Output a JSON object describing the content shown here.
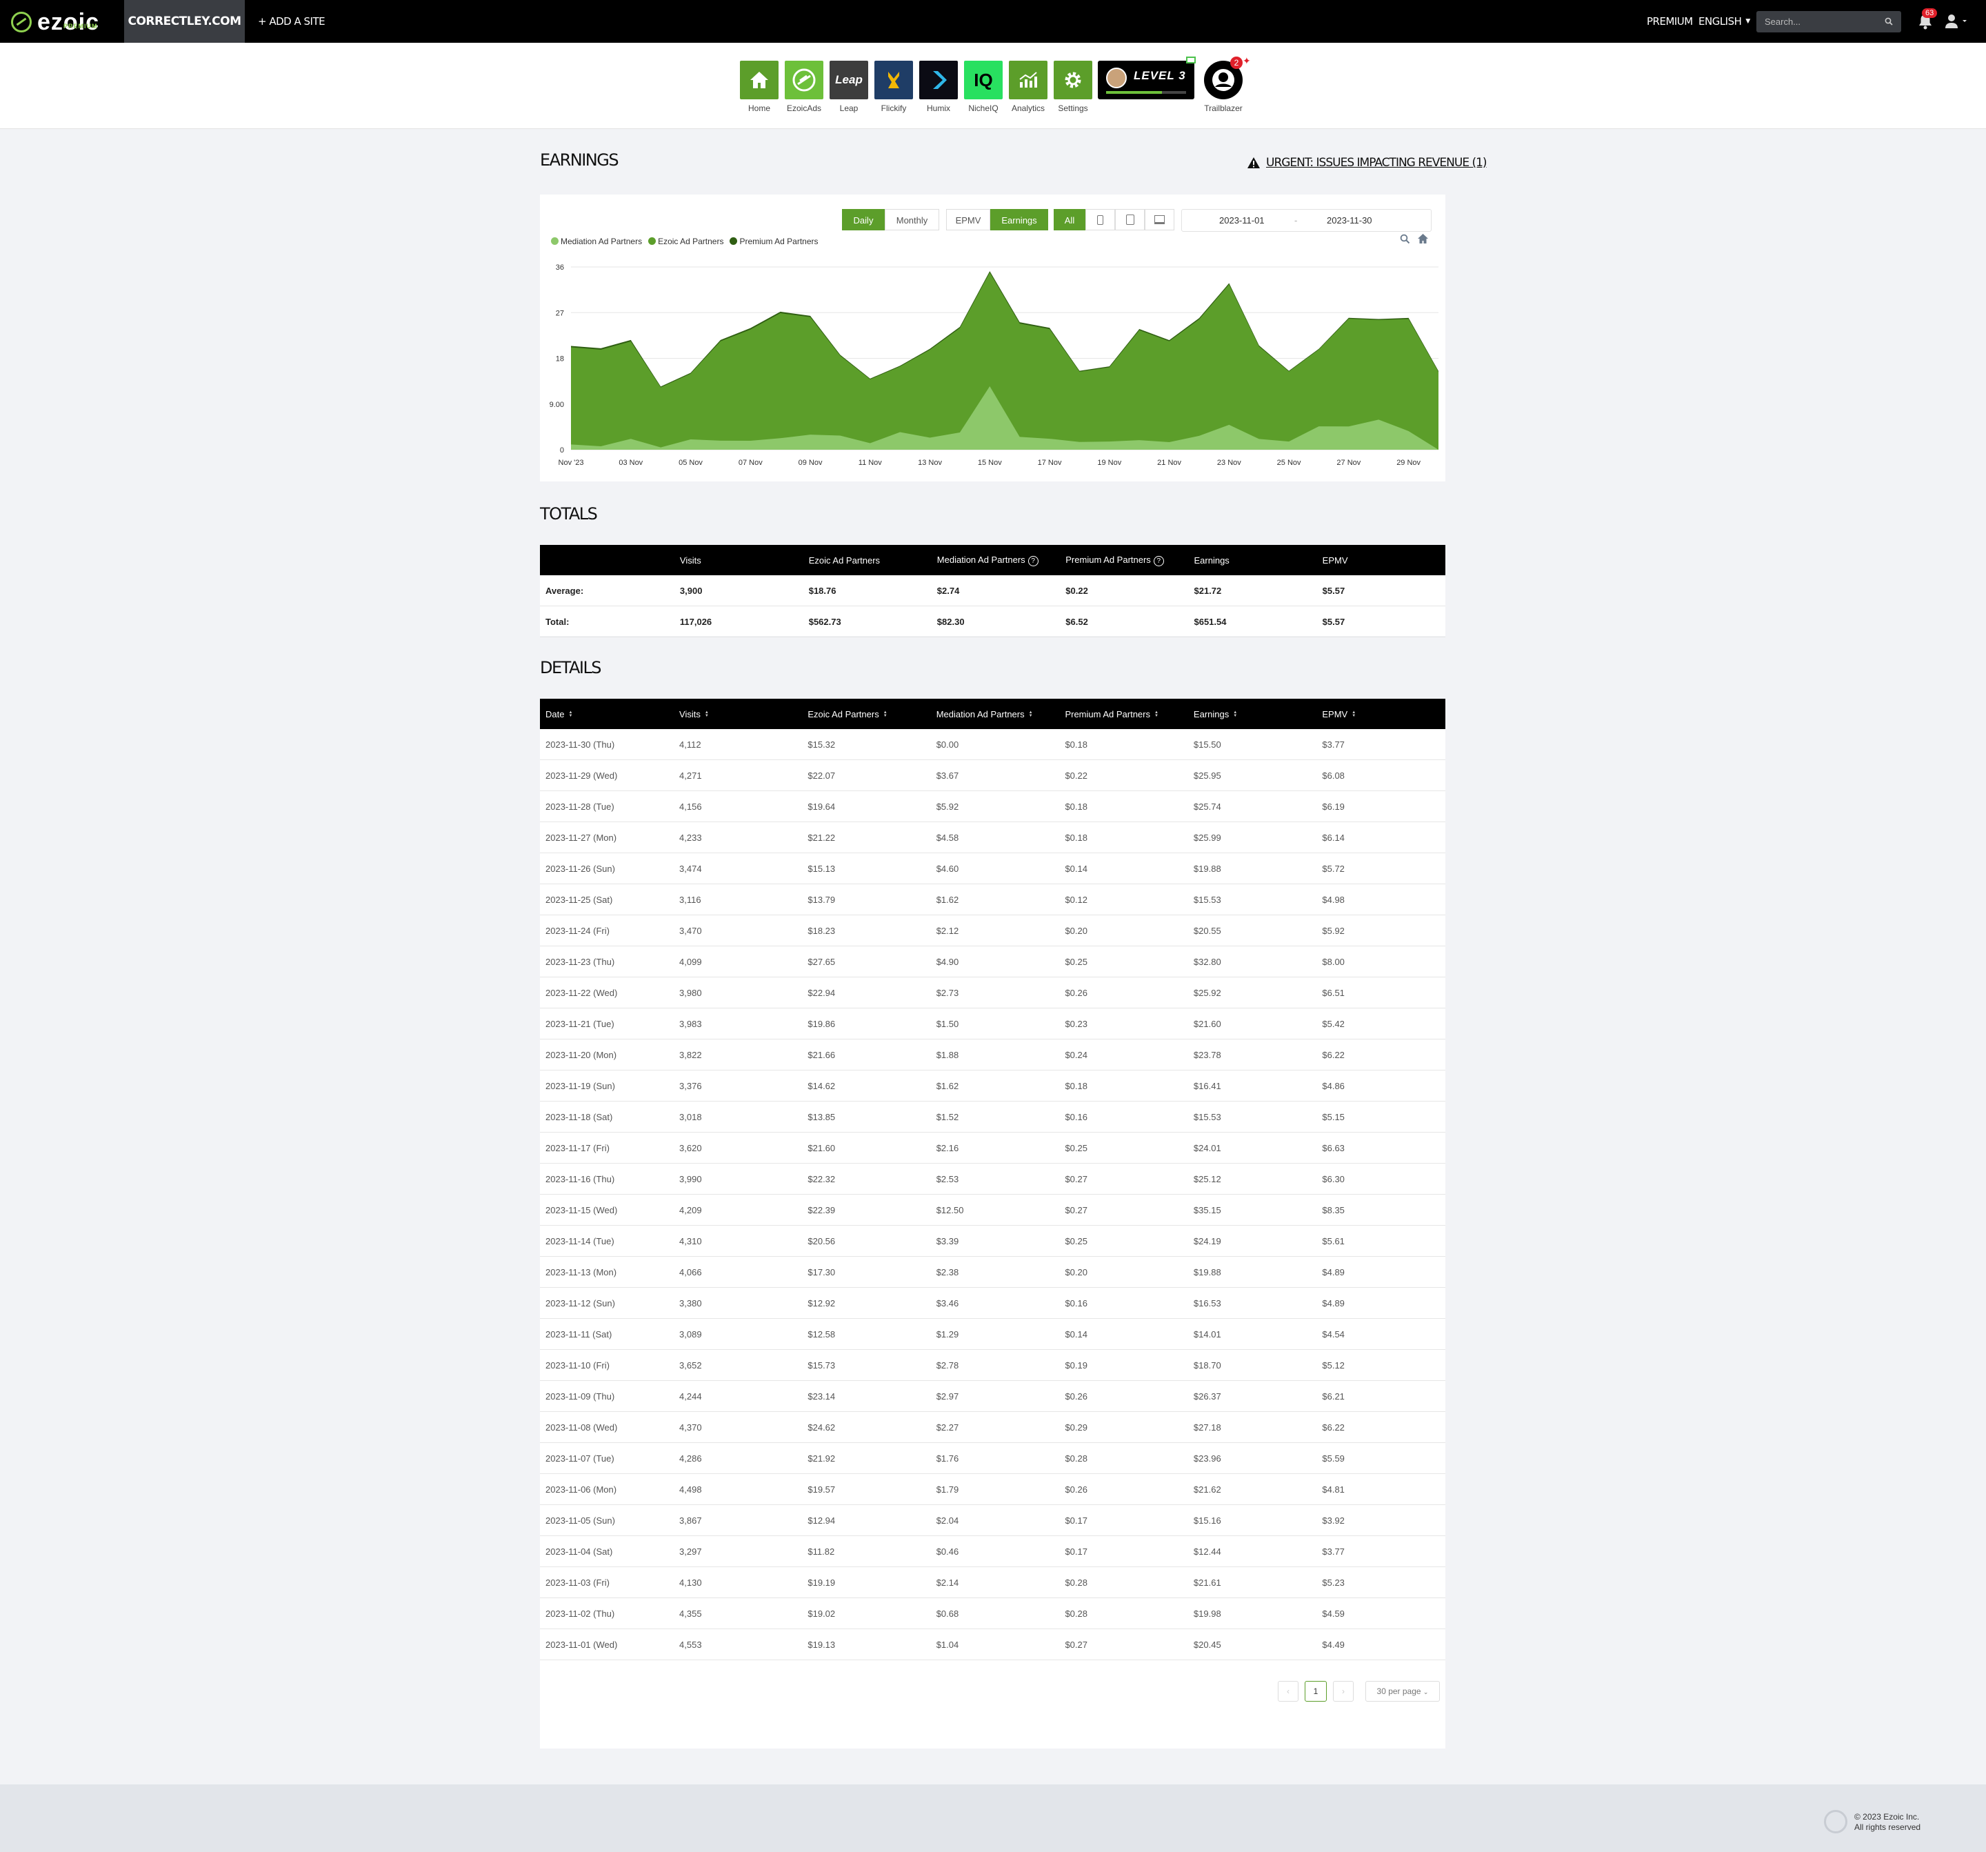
{
  "topbar": {
    "logo": "ezoic",
    "logo_sub": "PREMIUM",
    "site": "CORRECTLEY.COM",
    "add_site": "+ ADD A SITE",
    "premium": "PREMIUM",
    "language": "ENGLISH",
    "search_placeholder": "Search...",
    "notifications": "63"
  },
  "nav": [
    {
      "label": "Home",
      "color": "#5c9e2a",
      "icon": "home-icon"
    },
    {
      "label": "EzoicAds",
      "color": "#6dc03a",
      "icon": "ezoicads-icon"
    },
    {
      "label": "Leap",
      "color": "#3d3d3d",
      "icon": "leap-icon",
      "text": "Leap"
    },
    {
      "label": "Flickify",
      "color": "#1f3d66",
      "icon": "flickify-icon"
    },
    {
      "label": "Humix",
      "color": "#0b0b14",
      "icon": "humix-icon"
    },
    {
      "label": "NicheIQ",
      "color": "#28e060",
      "icon": "nicheiq-icon",
      "text": "IQ"
    },
    {
      "label": "Analytics",
      "color": "#5c9e2a",
      "icon": "analytics-icon"
    },
    {
      "label": "Settings",
      "color": "#5c9e2a",
      "icon": "settings-icon"
    }
  ],
  "level": "LEVEL 3",
  "trailblazer": {
    "label": "Trailblazer",
    "badge": "2"
  },
  "earnings": {
    "title": "EARNINGS",
    "urgent": "URGENT: ISSUES IMPACTING REVENUE (1)",
    "buttons": {
      "daily": "Daily",
      "monthly": "Monthly",
      "epmv": "EPMV",
      "earnings": "Earnings",
      "all": "All"
    },
    "date_from": "2023-11-01",
    "date_sep": "-",
    "date_to": "2023-11-30"
  },
  "chart_data": {
    "type": "area",
    "stacked": true,
    "x": [
      "Nov '23",
      "02 Nov",
      "03 Nov",
      "04 Nov",
      "05 Nov",
      "06 Nov",
      "07 Nov",
      "08 Nov",
      "09 Nov",
      "10 Nov",
      "11 Nov",
      "12 Nov",
      "13 Nov",
      "14 Nov",
      "15 Nov",
      "16 Nov",
      "17 Nov",
      "18 Nov",
      "19 Nov",
      "20 Nov",
      "21 Nov",
      "22 Nov",
      "23 Nov",
      "24 Nov",
      "25 Nov",
      "26 Nov",
      "27 Nov",
      "28 Nov",
      "29 Nov",
      "30 Nov"
    ],
    "x_tick_labels": [
      "Nov '23",
      "03 Nov",
      "05 Nov",
      "07 Nov",
      "09 Nov",
      "11 Nov",
      "13 Nov",
      "15 Nov",
      "17 Nov",
      "19 Nov",
      "21 Nov",
      "23 Nov",
      "25 Nov",
      "27 Nov",
      "29 Nov"
    ],
    "y_ticks": [
      "0",
      "9.00",
      "18",
      "27",
      "36"
    ],
    "ylim": [
      0,
      36
    ],
    "grid": true,
    "legend": "top-left",
    "series": [
      {
        "name": "Mediation Ad Partners",
        "color": "#8dc86a",
        "values": [
          1.04,
          0.68,
          2.14,
          0.46,
          2.04,
          1.79,
          1.76,
          2.27,
          2.97,
          2.78,
          1.29,
          3.46,
          2.38,
          3.39,
          12.5,
          2.53,
          2.16,
          1.52,
          1.62,
          1.88,
          1.5,
          2.73,
          4.9,
          2.12,
          1.62,
          4.6,
          4.58,
          5.92,
          3.67,
          0.0
        ]
      },
      {
        "name": "Ezoic Ad Partners",
        "color": "#5c9e2a",
        "values": [
          19.13,
          19.02,
          19.19,
          11.82,
          12.94,
          19.57,
          21.92,
          24.62,
          23.14,
          15.73,
          12.58,
          12.92,
          17.3,
          20.56,
          22.39,
          22.32,
          21.6,
          13.85,
          14.62,
          21.66,
          19.86,
          22.94,
          27.65,
          18.23,
          13.79,
          15.13,
          21.22,
          19.64,
          22.07,
          15.32
        ]
      },
      {
        "name": "Premium Ad Partners",
        "color": "#2f5e12",
        "values": [
          0.27,
          0.28,
          0.28,
          0.17,
          0.17,
          0.26,
          0.28,
          0.29,
          0.26,
          0.19,
          0.14,
          0.16,
          0.2,
          0.25,
          0.27,
          0.27,
          0.25,
          0.16,
          0.18,
          0.24,
          0.23,
          0.26,
          0.25,
          0.2,
          0.12,
          0.14,
          0.18,
          0.18,
          0.22,
          0.18
        ]
      }
    ]
  },
  "totals": {
    "title": "TOTALS",
    "headers": [
      "",
      "Visits",
      "Ezoic Ad Partners",
      "Mediation Ad Partners",
      "Premium Ad Partners",
      "Earnings",
      "EPMV"
    ],
    "rows": [
      [
        "Average:",
        "3,900",
        "$18.76",
        "$2.74",
        "$0.22",
        "$21.72",
        "$5.57"
      ],
      [
        "Total:",
        "117,026",
        "$562.73",
        "$82.30",
        "$6.52",
        "$651.54",
        "$5.57"
      ]
    ]
  },
  "details": {
    "title": "DETAILS",
    "headers": [
      "Date",
      "Visits",
      "Ezoic Ad Partners",
      "Mediation Ad Partners",
      "Premium Ad Partners",
      "Earnings",
      "EPMV"
    ],
    "rows": [
      [
        "2023-11-30 (Thu)",
        "4,112",
        "$15.32",
        "$0.00",
        "$0.18",
        "$15.50",
        "$3.77"
      ],
      [
        "2023-11-29 (Wed)",
        "4,271",
        "$22.07",
        "$3.67",
        "$0.22",
        "$25.95",
        "$6.08"
      ],
      [
        "2023-11-28 (Tue)",
        "4,156",
        "$19.64",
        "$5.92",
        "$0.18",
        "$25.74",
        "$6.19"
      ],
      [
        "2023-11-27 (Mon)",
        "4,233",
        "$21.22",
        "$4.58",
        "$0.18",
        "$25.99",
        "$6.14"
      ],
      [
        "2023-11-26 (Sun)",
        "3,474",
        "$15.13",
        "$4.60",
        "$0.14",
        "$19.88",
        "$5.72"
      ],
      [
        "2023-11-25 (Sat)",
        "3,116",
        "$13.79",
        "$1.62",
        "$0.12",
        "$15.53",
        "$4.98"
      ],
      [
        "2023-11-24 (Fri)",
        "3,470",
        "$18.23",
        "$2.12",
        "$0.20",
        "$20.55",
        "$5.92"
      ],
      [
        "2023-11-23 (Thu)",
        "4,099",
        "$27.65",
        "$4.90",
        "$0.25",
        "$32.80",
        "$8.00"
      ],
      [
        "2023-11-22 (Wed)",
        "3,980",
        "$22.94",
        "$2.73",
        "$0.26",
        "$25.92",
        "$6.51"
      ],
      [
        "2023-11-21 (Tue)",
        "3,983",
        "$19.86",
        "$1.50",
        "$0.23",
        "$21.60",
        "$5.42"
      ],
      [
        "2023-11-20 (Mon)",
        "3,822",
        "$21.66",
        "$1.88",
        "$0.24",
        "$23.78",
        "$6.22"
      ],
      [
        "2023-11-19 (Sun)",
        "3,376",
        "$14.62",
        "$1.62",
        "$0.18",
        "$16.41",
        "$4.86"
      ],
      [
        "2023-11-18 (Sat)",
        "3,018",
        "$13.85",
        "$1.52",
        "$0.16",
        "$15.53",
        "$5.15"
      ],
      [
        "2023-11-17 (Fri)",
        "3,620",
        "$21.60",
        "$2.16",
        "$0.25",
        "$24.01",
        "$6.63"
      ],
      [
        "2023-11-16 (Thu)",
        "3,990",
        "$22.32",
        "$2.53",
        "$0.27",
        "$25.12",
        "$6.30"
      ],
      [
        "2023-11-15 (Wed)",
        "4,209",
        "$22.39",
        "$12.50",
        "$0.27",
        "$35.15",
        "$8.35"
      ],
      [
        "2023-11-14 (Tue)",
        "4,310",
        "$20.56",
        "$3.39",
        "$0.25",
        "$24.19",
        "$5.61"
      ],
      [
        "2023-11-13 (Mon)",
        "4,066",
        "$17.30",
        "$2.38",
        "$0.20",
        "$19.88",
        "$4.89"
      ],
      [
        "2023-11-12 (Sun)",
        "3,380",
        "$12.92",
        "$3.46",
        "$0.16",
        "$16.53",
        "$4.89"
      ],
      [
        "2023-11-11 (Sat)",
        "3,089",
        "$12.58",
        "$1.29",
        "$0.14",
        "$14.01",
        "$4.54"
      ],
      [
        "2023-11-10 (Fri)",
        "3,652",
        "$15.73",
        "$2.78",
        "$0.19",
        "$18.70",
        "$5.12"
      ],
      [
        "2023-11-09 (Thu)",
        "4,244",
        "$23.14",
        "$2.97",
        "$0.26",
        "$26.37",
        "$6.21"
      ],
      [
        "2023-11-08 (Wed)",
        "4,370",
        "$24.62",
        "$2.27",
        "$0.29",
        "$27.18",
        "$6.22"
      ],
      [
        "2023-11-07 (Tue)",
        "4,286",
        "$21.92",
        "$1.76",
        "$0.28",
        "$23.96",
        "$5.59"
      ],
      [
        "2023-11-06 (Mon)",
        "4,498",
        "$19.57",
        "$1.79",
        "$0.26",
        "$21.62",
        "$4.81"
      ],
      [
        "2023-11-05 (Sun)",
        "3,867",
        "$12.94",
        "$2.04",
        "$0.17",
        "$15.16",
        "$3.92"
      ],
      [
        "2023-11-04 (Sat)",
        "3,297",
        "$11.82",
        "$0.46",
        "$0.17",
        "$12.44",
        "$3.77"
      ],
      [
        "2023-11-03 (Fri)",
        "4,130",
        "$19.19",
        "$2.14",
        "$0.28",
        "$21.61",
        "$5.23"
      ],
      [
        "2023-11-02 (Thu)",
        "4,355",
        "$19.02",
        "$0.68",
        "$0.28",
        "$19.98",
        "$4.59"
      ],
      [
        "2023-11-01 (Wed)",
        "4,553",
        "$19.13",
        "$1.04",
        "$0.27",
        "$20.45",
        "$4.49"
      ]
    ]
  },
  "pagination": {
    "prev": "‹",
    "page": "1",
    "next": "›",
    "per_page": "30 per page"
  },
  "footer": {
    "line1": "© 2023 Ezoic Inc.",
    "line2": "All rights reserved"
  }
}
